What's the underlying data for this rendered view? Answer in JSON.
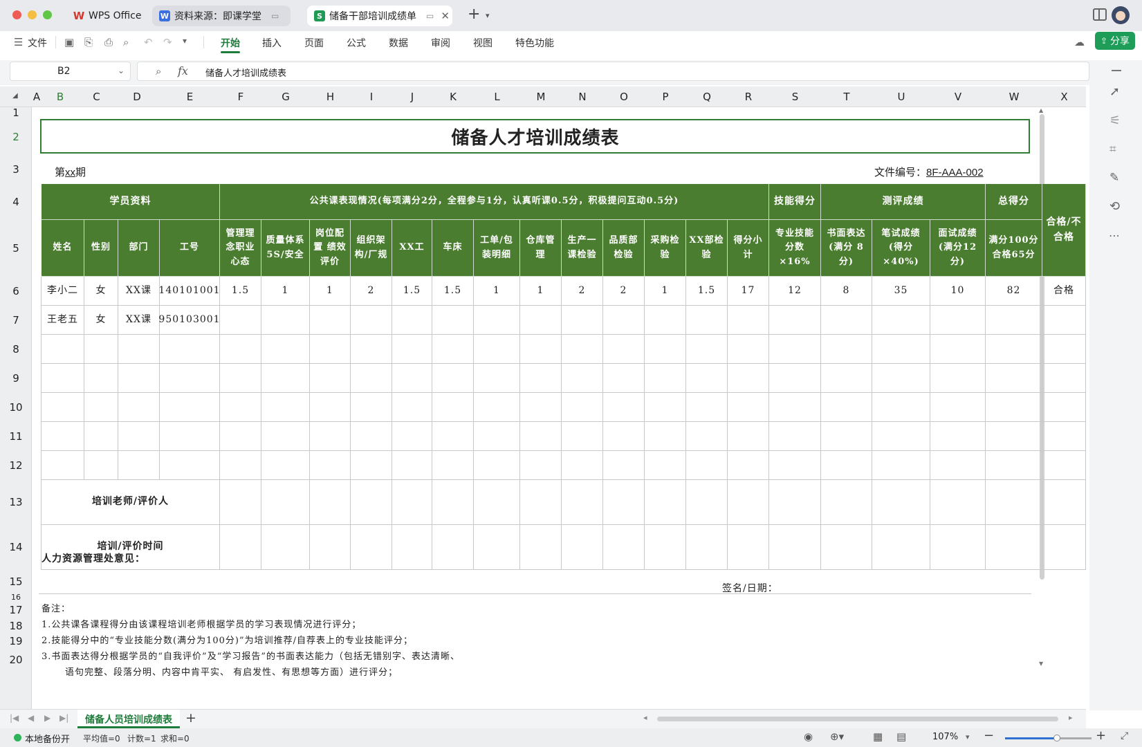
{
  "titlebar": {
    "tabs": [
      {
        "label": "WPS Office",
        "icon": "wps-logo-icon"
      },
      {
        "label": "资料来源：即课学堂",
        "icon": "word-doc-icon"
      },
      {
        "label": "储备干部培训成绩单",
        "icon": "sheet-doc-icon"
      }
    ]
  },
  "menu": {
    "file": "文件",
    "tabs": [
      "开始",
      "插入",
      "页面",
      "公式",
      "数据",
      "审阅",
      "视图",
      "特色功能"
    ],
    "active_tab": "开始",
    "share": "分享"
  },
  "formula_bar": {
    "cell_ref": "B2",
    "fx": "fx",
    "content": "储备人才培训成绩表"
  },
  "columns": [
    "A",
    "B",
    "C",
    "D",
    "E",
    "F",
    "G",
    "H",
    "I",
    "J",
    "K",
    "L",
    "M",
    "N",
    "O",
    "P",
    "Q",
    "R",
    "S",
    "T",
    "U",
    "V",
    "W",
    "X"
  ],
  "rows": [
    "1",
    "2",
    "3",
    "4",
    "5",
    "6",
    "7",
    "8",
    "9",
    "10",
    "11",
    "12",
    "13",
    "14",
    "15",
    "16",
    "17",
    "18",
    "19",
    "20"
  ],
  "sheet": {
    "title": "储备人才培训成绩表",
    "period_prefix": "第",
    "period_value": "xx",
    "period_suffix": "期",
    "doc_no_label": "文件编号：",
    "doc_no_value": "8F-AAA-002",
    "group_headers": {
      "student": "学员资料",
      "public": "公共课表现情况(每项满分2分，全程参与1分，认真听课0.5分，积极提问互动0.5分)",
      "skill": "技能得分",
      "eval": "测评成绩",
      "total": "总得分",
      "pass": "合格/不合格"
    },
    "col_headers": [
      "姓名",
      "性别",
      "部门",
      "工号",
      "管理理念职业心态",
      "质量体系 5S/安全",
      "岗位配置 绩效评价",
      "组织架构/厂规",
      "XX工",
      "车床",
      "工单/包装明细",
      "仓库管理",
      "生产一课检验",
      "品质部检验",
      "采购检验",
      "XX部检验",
      "得分小计",
      "专业技能分数×16%",
      "书面表达(满分 8分)",
      "笔试成绩(得分×40%)",
      "面试成绩(满分12分)",
      "满分100分合格65分"
    ],
    "data_rows": [
      [
        "李小二",
        "女",
        "XX课",
        "140101001",
        "1.5",
        "1",
        "1",
        "2",
        "1.5",
        "1.5",
        "1",
        "1",
        "2",
        "2",
        "1",
        "1.5",
        "17",
        "12",
        "8",
        "35",
        "10",
        "82",
        "合格"
      ],
      [
        "王老五",
        "女",
        "XX课",
        "950103001",
        "",
        "",
        "",
        "",
        "",
        "",
        "",
        "",
        "",
        "",
        "",
        "",
        "",
        "",
        "",
        "",
        "",
        "",
        ""
      ]
    ],
    "trainer_label": "培训老师/评价人",
    "time_label": "培训/评价时间",
    "hr_opinion": "人力资源管理处意见：",
    "sign_date": "签名/日期：",
    "notes": [
      "备注：",
      "1.公共课各课程得分由该课程培训老师根据学员的学习表现情况进行评分；",
      "2.技能得分中的“专业技能分数(满分为100分)”为培训推荐/自荐表上的专业技能评分；",
      "3.书面表达得分根据学员的“自我评价”及“学习报告”的书面表达能力（包括无错别字、表达清晰、",
      "语句完整、段落分明、内容中肯平实、 有启发性、有思想等方面）进行评分；"
    ]
  },
  "sheet_tab": "储备人员培训成绩表",
  "status": {
    "backup": "本地备份开",
    "avg": "平均值=0",
    "count": "计数=1",
    "sum": "求和=0",
    "zoom": "107%",
    "zoom_level": 0.6
  },
  "colors": {
    "header_green": "#4a7d2f",
    "accent_green": "#2f7d32",
    "share_green": "#1e9d58"
  }
}
